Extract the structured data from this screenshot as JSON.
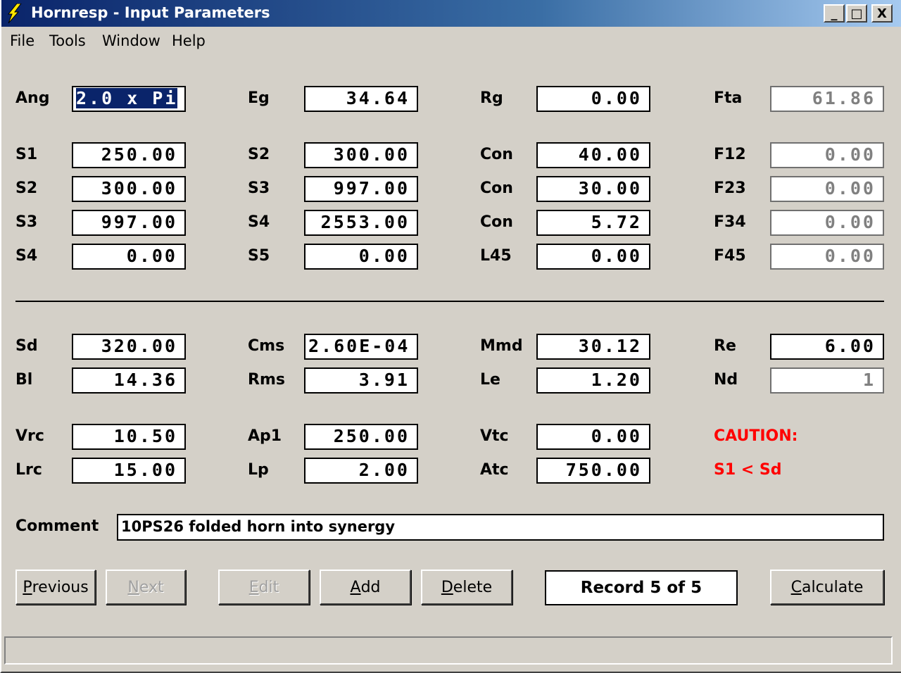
{
  "window": {
    "title": "Hornresp - Input Parameters",
    "icon": "lightning-bolt-icon",
    "controls": {
      "minimize": "_",
      "maximize": "□",
      "close": "X"
    }
  },
  "menu": [
    "File",
    "Tools",
    "Window",
    "Help"
  ],
  "fields": {
    "ang": {
      "label": "Ang",
      "value": "2.0 x Pi"
    },
    "eg": {
      "label": "Eg",
      "value": "34.64"
    },
    "rg": {
      "label": "Rg",
      "value": "0.00"
    },
    "fta": {
      "label": "Fta",
      "value": "61.86"
    },
    "s1_a": {
      "label": "S1",
      "value": "250.00"
    },
    "s2_a": {
      "label": "S2",
      "value": "300.00"
    },
    "con_a": {
      "label": "Con",
      "value": "40.00"
    },
    "f12": {
      "label": "F12",
      "value": "0.00"
    },
    "s2_b": {
      "label": "S2",
      "value": "300.00"
    },
    "s3_a": {
      "label": "S3",
      "value": "997.00"
    },
    "con_b": {
      "label": "Con",
      "value": "30.00"
    },
    "f23": {
      "label": "F23",
      "value": "0.00"
    },
    "s3_b": {
      "label": "S3",
      "value": "997.00"
    },
    "s4_a": {
      "label": "S4",
      "value": "2553.00"
    },
    "con_c": {
      "label": "Con",
      "value": "5.72"
    },
    "f34": {
      "label": "F34",
      "value": "0.00"
    },
    "s4_b": {
      "label": "S4",
      "value": "0.00"
    },
    "s5": {
      "label": "S5",
      "value": "0.00"
    },
    "l45": {
      "label": "L45",
      "value": "0.00"
    },
    "f45": {
      "label": "F45",
      "value": "0.00"
    },
    "sd": {
      "label": "Sd",
      "value": "320.00"
    },
    "cms": {
      "label": "Cms",
      "value": "2.60E-04"
    },
    "mmd": {
      "label": "Mmd",
      "value": "30.12"
    },
    "re": {
      "label": "Re",
      "value": "6.00"
    },
    "bl": {
      "label": "Bl",
      "value": "14.36"
    },
    "rms": {
      "label": "Rms",
      "value": "3.91"
    },
    "le": {
      "label": "Le",
      "value": "1.20"
    },
    "nd": {
      "label": "Nd",
      "value": "1"
    },
    "vrc": {
      "label": "Vrc",
      "value": "10.50"
    },
    "ap1": {
      "label": "Ap1",
      "value": "250.00"
    },
    "vtc": {
      "label": "Vtc",
      "value": "0.00"
    },
    "lrc": {
      "label": "Lrc",
      "value": "15.00"
    },
    "lp": {
      "label": "Lp",
      "value": "2.00"
    },
    "atc": {
      "label": "Atc",
      "value": "750.00"
    }
  },
  "caution": {
    "title": "CAUTION:",
    "message": "S1 < Sd",
    "color": "#ff0000"
  },
  "comment": {
    "label": "Comment",
    "value": "10PS26 folded horn into synergy"
  },
  "buttons": {
    "previous": {
      "pre": "",
      "key": "P",
      "post": "revious"
    },
    "next": {
      "pre": "",
      "key": "N",
      "post": "ext"
    },
    "edit": {
      "pre": "",
      "key": "E",
      "post": "dit"
    },
    "add": {
      "pre": "",
      "key": "A",
      "post": "dd"
    },
    "delete": {
      "pre": "",
      "key": "D",
      "post": "elete"
    },
    "calculate": {
      "pre": "",
      "key": "C",
      "post": "alculate"
    }
  },
  "record": "Record 5 of 5",
  "colors": {
    "titlebar_start": "#0a246a",
    "face": "#d4d0c8",
    "selection": "#0a246a"
  }
}
